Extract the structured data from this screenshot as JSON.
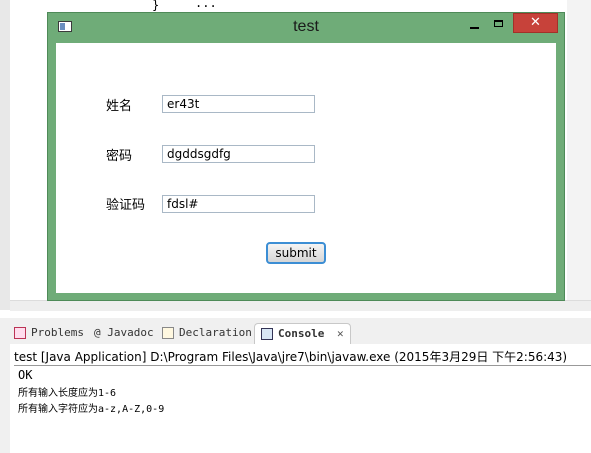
{
  "editor": {
    "code_brace": "}",
    "code_fragment": "..."
  },
  "window": {
    "title": "test",
    "close_glyph": "✕",
    "form": {
      "name_label": "姓名",
      "name_value": "er43t",
      "password_label": "密码",
      "password_value": "dgddsgdfg",
      "captcha_label": "验证码",
      "captcha_value": "fdsl#",
      "submit_label": "submit"
    }
  },
  "views": {
    "tabs": [
      {
        "label": "Problems",
        "icon": "problems-icon"
      },
      {
        "label": "@ Javadoc",
        "icon": "javadoc-icon"
      },
      {
        "label": "Declaration",
        "icon": "declaration-icon"
      },
      {
        "label": "Console",
        "icon": "console-icon",
        "close": "✕"
      }
    ]
  },
  "console": {
    "header": "test [Java Application] D:\\Program Files\\Java\\jre7\\bin\\javaw.exe (2015年3月29日 下午2:56:43)",
    "lines": [
      "OK",
      "所有输入长度应为1-6",
      "所有输入字符应为a-z,A-Z,0-9"
    ]
  },
  "colors": {
    "window_frame": "#6fac78",
    "close_button": "#c7423a",
    "focus_border": "#3c8ed4"
  }
}
